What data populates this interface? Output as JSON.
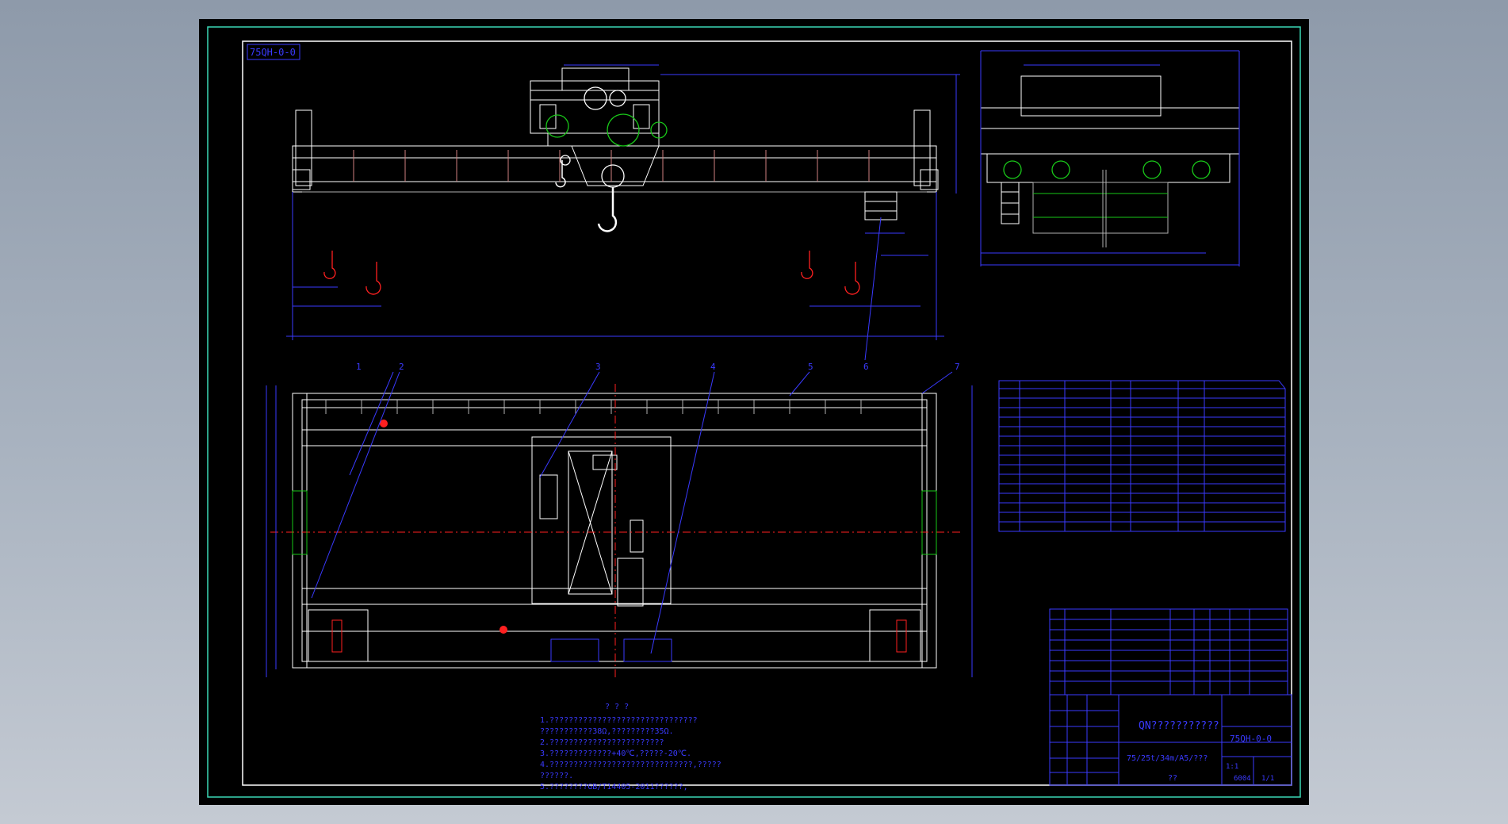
{
  "drawing": {
    "stamp_label": "75QH-0-0",
    "title_block": {
      "name": "QN???????????",
      "number": "75QH-0-0",
      "spec": "75/25t/34m/A5/???",
      "scale": "??",
      "sheet": "1:1",
      "total": "6004",
      "page": "1/1"
    },
    "notes": {
      "heading": "?  ?  ?",
      "lines": [
        "1.???????????????????????????????",
        "  ???????????38Ω,?????????35Ω.",
        "2.????????????????????????",
        "3.?????????????+40℃,?????-20℃.",
        "4.??????????????????????????????,?????",
        "  ??????.",
        "5.????????GB/T14405-2011??????,"
      ]
    },
    "balloons": [
      "1",
      "2",
      "3",
      "4",
      "5",
      "6",
      "7"
    ],
    "colors": {
      "background": "#000000",
      "frame": "#ffffff",
      "outer_border": "#3ad8b6",
      "dimension": "#3a3aff",
      "marker": "#ff2020",
      "green": "#19c819",
      "gray": "#b0b0b0"
    }
  }
}
